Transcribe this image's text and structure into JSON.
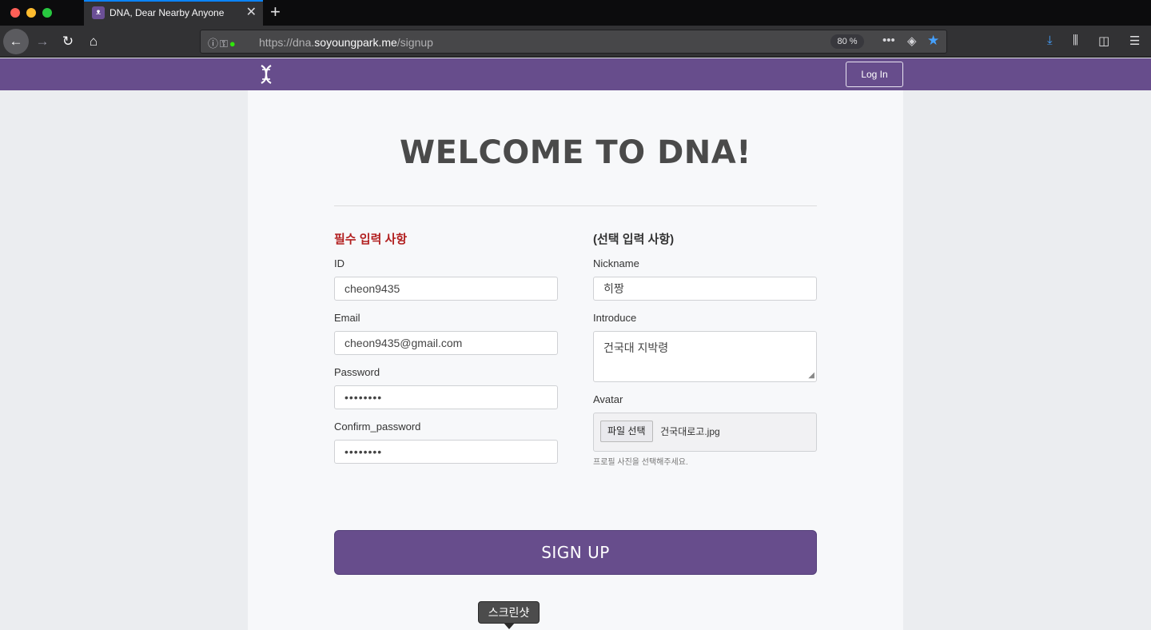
{
  "browser": {
    "tab_title": "DNA, Dear Nearby Anyone",
    "new_tab": "+",
    "tab_close": "✕",
    "url_prefix": "https://dna.",
    "url_domain": "soyoungpark.me",
    "url_path": "/signup",
    "zoom": "80 %",
    "more_actions": "•••",
    "icons": {
      "back": "←",
      "forward": "→",
      "reload": "↻",
      "home": "⌂",
      "info": "ⓘ",
      "key": "⚿",
      "lock": "🔒",
      "pocket": "◈",
      "bookmark_star": "★",
      "download": "⤓",
      "library": "⫼",
      "sidebar": "◫",
      "menu": "☰"
    }
  },
  "header": {
    "logo_glyph": "ᴥ",
    "login_label": "Log In"
  },
  "page": {
    "title": "WELCOME TO DNA!",
    "required_title": "필수 입력 사항",
    "optional_title": "(선택 입력 사항)",
    "fields": {
      "id_label": "ID",
      "id_value": "cheon9435",
      "email_label": "Email",
      "email_value": "cheon9435@gmail.com",
      "password_label": "Password",
      "password_value": "••••••••",
      "confirm_label": "Confirm_password",
      "confirm_value": "••••••••",
      "nickname_label": "Nickname",
      "nickname_value": "히짱",
      "introduce_label": "Introduce",
      "introduce_value": "건국대 지박령",
      "avatar_label": "Avatar",
      "file_button": "파일 선택",
      "file_name": "건국대로고.jpg",
      "avatar_help": "프로필 사진을 선택해주세요."
    },
    "signup_label": "SIGN UP"
  },
  "screenshot_tooltip": "스크린샷",
  "colors": {
    "brand": "#674d8c",
    "required": "#b21f1f",
    "tab_accent": "#0a84ff"
  }
}
